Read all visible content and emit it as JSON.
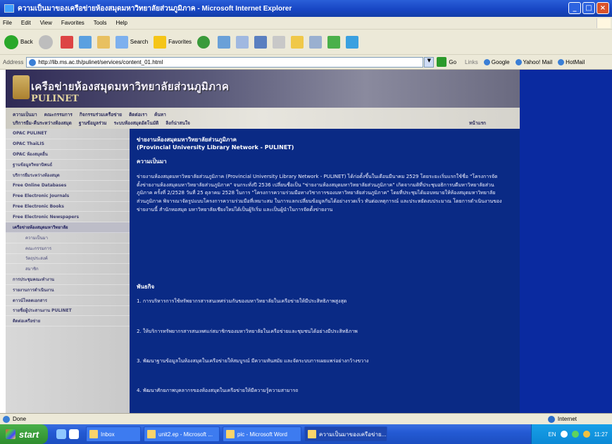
{
  "window": {
    "title": "ความเป็นมาของเครือข่ายห้องสมุดมหาวิทยาลัยส่วนภูมิภาค - Microsoft Internet Explorer",
    "min": "_",
    "max": "□",
    "close": "×"
  },
  "menu": [
    "File",
    "Edit",
    "View",
    "Favorites",
    "Tools",
    "Help"
  ],
  "toolbar": {
    "back": "Back",
    "search": "Search",
    "favorites": "Favorites"
  },
  "address": {
    "label": "Address",
    "url": "http://lib.ms.ac.th/pulinet/services/content_01.html",
    "go": "Go",
    "links_label": "Links",
    "links": [
      "Google",
      "Yahoo! Mail",
      "HotMail"
    ]
  },
  "site": {
    "banner_title": "เครือข่ายห้องสมุดมหาวิทยาลัยส่วนภูมิภาค",
    "banner_sub": "PULINET",
    "nav_row1": [
      "ความเป็นมา",
      "คณะกรรมการ",
      "กิจกรรมร่วมเครือข่าย",
      "ติดต่อเรา",
      "ค้นหา"
    ],
    "nav_row2": [
      "บริการยืม-คืนระหว่างห้องสมุด",
      "ฐานข้อมูลร่วม",
      "ระบบห้องสมุดอัตโนมัติ",
      "ลิงก์น่าสนใจ"
    ],
    "home": "หน้าแรก",
    "sidebar": [
      {
        "label": "OPAC PULINET",
        "type": "item"
      },
      {
        "label": "OPAC ThaiLIS",
        "type": "item"
      },
      {
        "label": "OPAC ห้องสมุดอื่น",
        "type": "item"
      },
      {
        "label": "ฐานข้อมูลวิทยานิพนธ์",
        "type": "item"
      },
      {
        "label": "บริการยืมระหว่างห้องสมุด",
        "type": "item"
      },
      {
        "label": "Free Online Databases",
        "type": "item"
      },
      {
        "label": "Free Electronic Journals",
        "type": "item"
      },
      {
        "label": "Free Electronic Books",
        "type": "item"
      },
      {
        "label": "Free Electronic Newspapers",
        "type": "item"
      },
      {
        "label": "เครือข่ายห้องสมุดมหาวิทยาลัย",
        "type": "active"
      },
      {
        "label": "ความเป็นมา",
        "type": "sub"
      },
      {
        "label": "คณะกรรมการ",
        "type": "sub"
      },
      {
        "label": "วัตถุประสงค์",
        "type": "sub"
      },
      {
        "label": "สมาชิก",
        "type": "sub"
      },
      {
        "label": "การประชุมคณะทำงาน",
        "type": "item"
      },
      {
        "label": "รายงานการดำเนินงาน",
        "type": "item"
      },
      {
        "label": "ดาวน์โหลดเอกสาร",
        "type": "item"
      },
      {
        "label": "รายชื่อผู้ประสานงาน PULINET",
        "type": "item"
      },
      {
        "label": "ติดต่อเครือข่าย",
        "type": "item"
      }
    ],
    "heading1": "ข่ายงานห้องสมุดมหาวิทยาลัยส่วนภูมิภาค",
    "heading2": "(Provincial University Library Network - PULINET)",
    "section1": "ความเป็นมา",
    "para1": "ข่ายงานห้องสมุดมหาวิทยาลัยส่วนภูมิภาค (Provincial University Library Network - PULINET) ได้ก่อตั้งขึ้นในเดือนมีนาคม 2529 โดยระยะเริ่มแรกใช้ชื่อ \"โครงการจัดตั้งข่ายงานห้องสมุดมหาวิทยาลัยส่วนภูมิภาค\" จนกระทั่งปี 2536 เปลี่ยนชื่อเป็น \"ข่ายงานห้องสมุดมหาวิทยาลัยส่วนภูมิภาค\" เกิดจากมติที่ประชุมอธิการบดีมหาวิทยาลัยส่วนภูมิภาค ครั้งที่ 2/2528 วันที่ 25 ตุลาคม 2528 ในการ \"โครงการความร่วมมือทางวิชาการของมหาวิทยาลัยส่วนภูมิภาค\" โดยที่ประชุมได้มอบหมายให้ห้องสมุดมหาวิทยาลัยส่วนภูมิภาค พิจารณาจัดรูปแบบโครงการความร่วมมือที่เหมาะสม ในการแลกเปลี่ยนข้อมูลกันได้อย่างรวดเร็ว ทันต่อเหตุการณ์ และประหยัดงบประมาณ โดยการดำเนินงานของข่ายงานนี้ สำนักหอสมุด มหาวิทยาลัยเชียงใหม่ได้เป็นผู้ริเริ่ม และเป็นผู้นำในการจัดตั้งข่ายงาน",
    "section2": "พันธกิจ",
    "mission1": "1. การบริหารการใช้ทรัพยากรสารสนเทศร่วมกันของมหาวิทยาลัยในเครือข่ายให้มีประสิทธิภาพสูงสุด",
    "mission2": "2. ให้บริการทรัพยากรสารสนเทศแก่สมาชิกของมหาวิทยาลัยในเครือข่ายและชุมชนได้อย่างมีประสิทธิภาพ",
    "mission3": "3. พัฒนาฐานข้อมูลในห้องสมุดในเครือข่ายให้สมบูรณ์ มีความทันสมัย และจัดระบบการเผยแพร่อย่างกว้างขวาง",
    "mission4": "4. พัฒนาศักยภาพบุคลากรของห้องสมุดในเครือข่ายให้มีความรู้ความสามารถ"
  },
  "status": {
    "left": "Done",
    "zone": "Internet"
  },
  "taskbar": {
    "start": "start",
    "tasks": [
      "Inbox",
      "unit2.ep - Microsoft ...",
      "pic - Microsoft Word",
      "ความเป็นมาของเครือข่าย..."
    ],
    "active_task": 3,
    "lang": "EN",
    "clock": "11:27"
  }
}
